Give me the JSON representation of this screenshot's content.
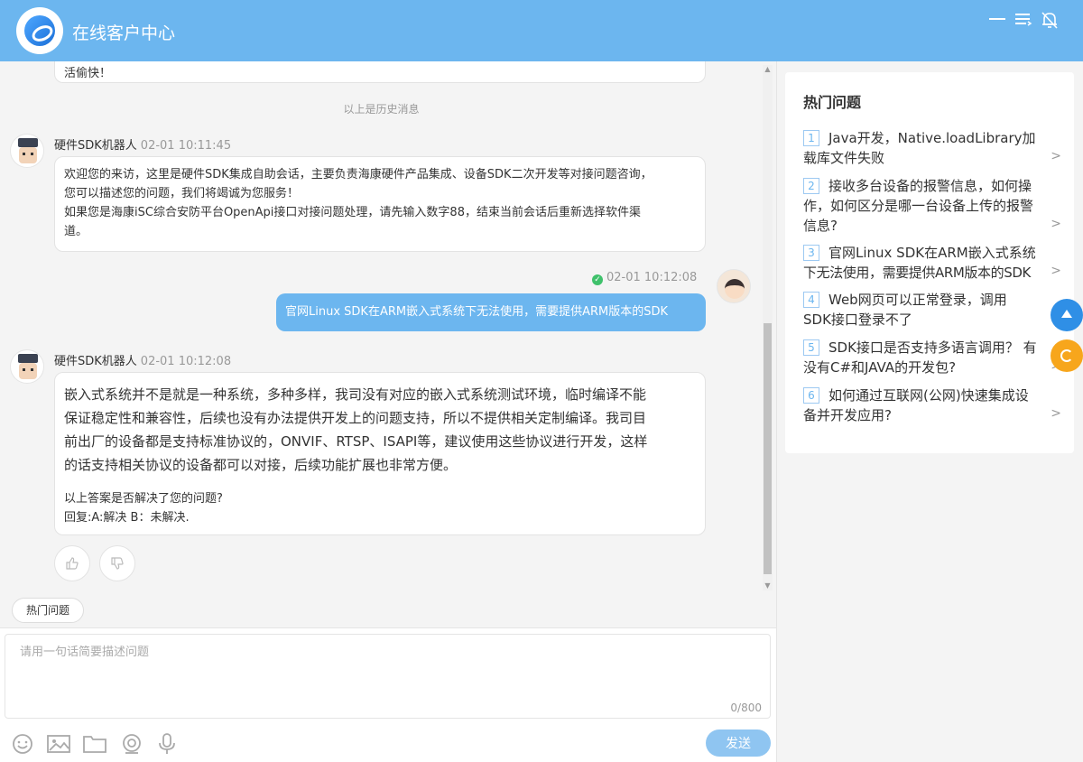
{
  "header": {
    "title": "在线客户中心",
    "icons": [
      "minimize-icon",
      "menu-icon",
      "bell-off-icon"
    ]
  },
  "chat": {
    "prev_text": "活偷快！",
    "history_tip": "以上是历史消息",
    "messages": [
      {
        "sender": "硬件SDK机器人",
        "time": "02-01 10:11:45",
        "lines": [
          "欢迎您的来访，这里是硬件SDK集成自助会话，主要负责海康硬件产品集成、设备SDK二次开发等对接问题咨询，",
          "您可以描述您的问题，我们将竭诚为您服务！",
          "如果您是海康iSC综合安防平台OpenApi接口对接问题处理，请先输入数字88，结束当前会话后重新选择软件渠",
          "道。"
        ]
      },
      {
        "sender": "user",
        "time": "02-01 10:12:08",
        "text": "官网Linux SDK在ARM嵌入式系统下无法使用，需要提供ARM版本的SDK"
      },
      {
        "sender": "硬件SDK机器人",
        "time": "02-01 10:12:08",
        "answer_lines": [
          "嵌入式系统并不是就是一种系统，多种多样，我司没有对应的嵌入式系统测试环境，临时编译不能",
          "保证稳定性和兼容性，后续也没有办法提供开发上的问题支持，所以不提供相关定制编译。我司目",
          "前出厂的设备都是支持标准协议的，ONVIF、RTSP、ISAPI等，建议使用这些协议进行开发，这样",
          "的话支持相关协议的设备都可以对接，后续功能扩展也非常方便。"
        ],
        "question": "以上答案是否解决了您的问题?",
        "reply": "回复:A:解决 B：未解决."
      }
    ],
    "vote": {
      "like_icon": "thumbs-up-icon",
      "dislike_icon": "thumbs-down-icon"
    }
  },
  "hot_tab": "热门问题",
  "input": {
    "placeholder": "请用一句话简要描述问题",
    "counter": "0/800",
    "send": "发送",
    "tools": [
      "emoji-icon",
      "image-icon",
      "folder-icon",
      "camera-icon",
      "microphone-icon"
    ]
  },
  "hot_panel": {
    "title": "热门问题",
    "items": [
      {
        "num": "1",
        "line1": "Java开发，Native.loadLibrary加",
        "line2": "载库文件失败"
      },
      {
        "num": "2",
        "line1": "接收多台设备的报警信息，如何操",
        "line2": "作，如何区分是哪一台设备上传的报警",
        "line3": "信息?"
      },
      {
        "num": "3",
        "line1": "官网Linux SDK在ARM嵌入式系统",
        "line2": "下无法使用，需要提供ARM版本的SDK"
      },
      {
        "num": "4",
        "line1": "Web网页可以正常登录，调用",
        "line2": "SDK接口登录不了"
      },
      {
        "num": "5",
        "line1": "SDK接口是否支持多语言调用？ 有",
        "line2": "没有C#和JAVA的开发包?"
      },
      {
        "num": "6",
        "line1": "如何通过互联网(公网)快速集成设",
        "line2": "备并开发应用?"
      }
    ]
  },
  "colors": {
    "brand": "#6cb6ef",
    "float_up": "#2f8fe6",
    "float_refresh": "#f7a61c"
  }
}
